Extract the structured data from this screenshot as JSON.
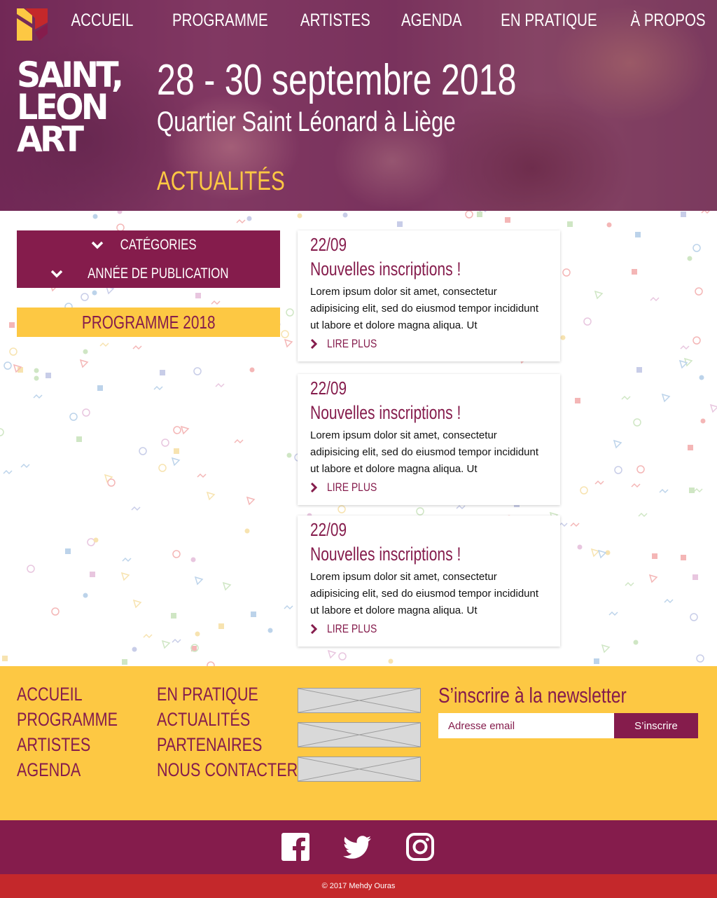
{
  "nav": {
    "items": [
      "ACCUEIL",
      "PROGRAMME",
      "ARTISTES",
      "AGENDA",
      "EN PRATIQUE",
      "À PROPOS"
    ]
  },
  "brand": {
    "lines": [
      "SAINT,",
      "LEON",
      "ART"
    ]
  },
  "hero": {
    "dates": "28 - 30 septembre 2018",
    "place": "Quartier Saint Léonard à Liège",
    "section_title": "ACTUALITÉS"
  },
  "filters": {
    "categories_label": "CATÉGORIES",
    "year_label": "ANNÉE DE PUBLICATION",
    "program_button": "PROGRAMME 2018"
  },
  "articles": [
    {
      "date": "22/09",
      "title": "Nouvelles inscriptions !",
      "excerpt": "Lorem ipsum dolor sit amet, consectetur adipisicing elit, sed do eiusmod tempor incididunt ut labore et dolore magna aliqua. Ut",
      "more": "LIRE PLUS"
    },
    {
      "date": "22/09",
      "title": "Nouvelles inscriptions !",
      "excerpt": "Lorem ipsum dolor sit amet, consectetur adipisicing elit, sed do eiusmod tempor incididunt ut labore et dolore magna aliqua. Ut",
      "more": "LIRE PLUS"
    },
    {
      "date": "22/09",
      "title": "Nouvelles inscriptions !",
      "excerpt": "Lorem ipsum dolor sit amet, consectetur adipisicing elit, sed do eiusmod tempor incididunt ut labore et dolore magna aliqua. Ut",
      "more": "LIRE PLUS"
    }
  ],
  "footer": {
    "col1": [
      "ACCUEIL",
      "PROGRAMME",
      "ARTISTES",
      "AGENDA"
    ],
    "col2": [
      "EN PRATIQUE",
      "ACTUALITÉS",
      "PARTENAIRES",
      "NOUS CONTACTER"
    ],
    "newsletter": {
      "title": "S’inscrire à la newsletter",
      "placeholder": "Adresse email",
      "button": "S’inscrire"
    }
  },
  "social": {
    "icons": [
      "facebook-icon",
      "twitter-icon",
      "instagram-icon"
    ]
  },
  "copyright": "© 2017 Mehdy Ouras",
  "colors": {
    "primary": "#851c4c",
    "accent": "#fdc843",
    "footer_bottom": "#c4282b"
  }
}
